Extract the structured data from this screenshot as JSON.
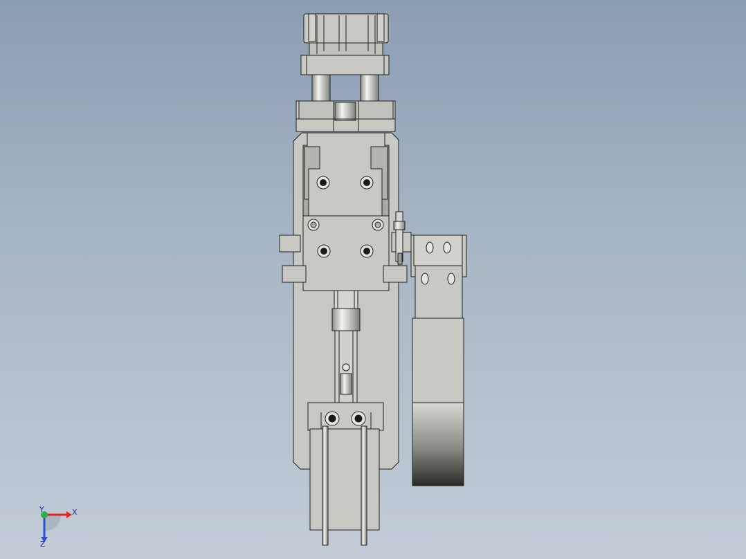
{
  "viewport": {
    "background_top": "#8c9db3",
    "background_bottom": "#c3ccd7",
    "part_color": "#c9c9c3",
    "edge_color": "#1e1e1e"
  },
  "triad": {
    "x_label": "X",
    "y_label": "Y",
    "z_label": "Z",
    "x_color": "#e0261e",
    "y_color": "#2bb34a",
    "z_color": "#2b4fd6"
  }
}
